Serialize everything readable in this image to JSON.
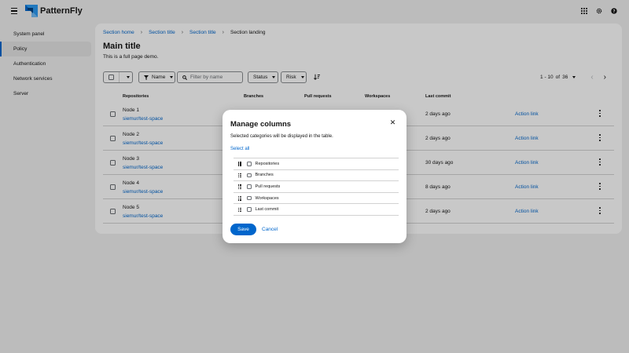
{
  "app": {
    "logo_text": "PatternFly"
  },
  "header": {
    "tools": [
      "grid-icon",
      "gear-icon",
      "help-icon"
    ]
  },
  "sidebar": {
    "items": [
      {
        "label": "System panel",
        "active": false
      },
      {
        "label": "Policy",
        "active": true
      },
      {
        "label": "Authentication",
        "active": false
      },
      {
        "label": "Network services",
        "active": false
      },
      {
        "label": "Server",
        "active": false
      }
    ]
  },
  "breadcrumb": [
    "Section home",
    "Section title",
    "Section title",
    "Section landing"
  ],
  "page": {
    "title": "Main title",
    "description": "This is a full page demo."
  },
  "toolbar": {
    "filter_attr": "Name",
    "search_placeholder": "Filter by name",
    "status_label": "Status",
    "risk_label": "Risk",
    "pagination": {
      "range": "1 - 10",
      "of_label": "of",
      "total": "36"
    }
  },
  "table": {
    "columns": [
      "Repositories",
      "Branches",
      "Pull requests",
      "Workspaces",
      "Last commit"
    ],
    "rows": [
      {
        "name": "Node 1",
        "repo": "siemur/test-space",
        "last_commit": "2 days ago",
        "action": "Action link"
      },
      {
        "name": "Node 2",
        "repo": "siemur/test-space",
        "last_commit": "2 days ago",
        "action": "Action link"
      },
      {
        "name": "Node 3",
        "repo": "siemur/test-space",
        "last_commit": "30 days ago",
        "action": "Action link"
      },
      {
        "name": "Node 4",
        "repo": "siemur/test-space",
        "last_commit": "8 days ago",
        "action": "Action link"
      },
      {
        "name": "Node 5",
        "repo": "siemur/test-space",
        "last_commit": "2 days ago",
        "action": "Action link"
      }
    ]
  },
  "modal": {
    "title": "Manage columns",
    "description": "Selected categories will be displayed in the table.",
    "select_all": "Select all",
    "columns": [
      "Repositories",
      "Branches",
      "Pull requests",
      "Workspaces",
      "Last commit"
    ],
    "save": "Save",
    "cancel": "Cancel"
  },
  "colors": {
    "accent": "#0066cc",
    "backdrop": "#030303"
  }
}
